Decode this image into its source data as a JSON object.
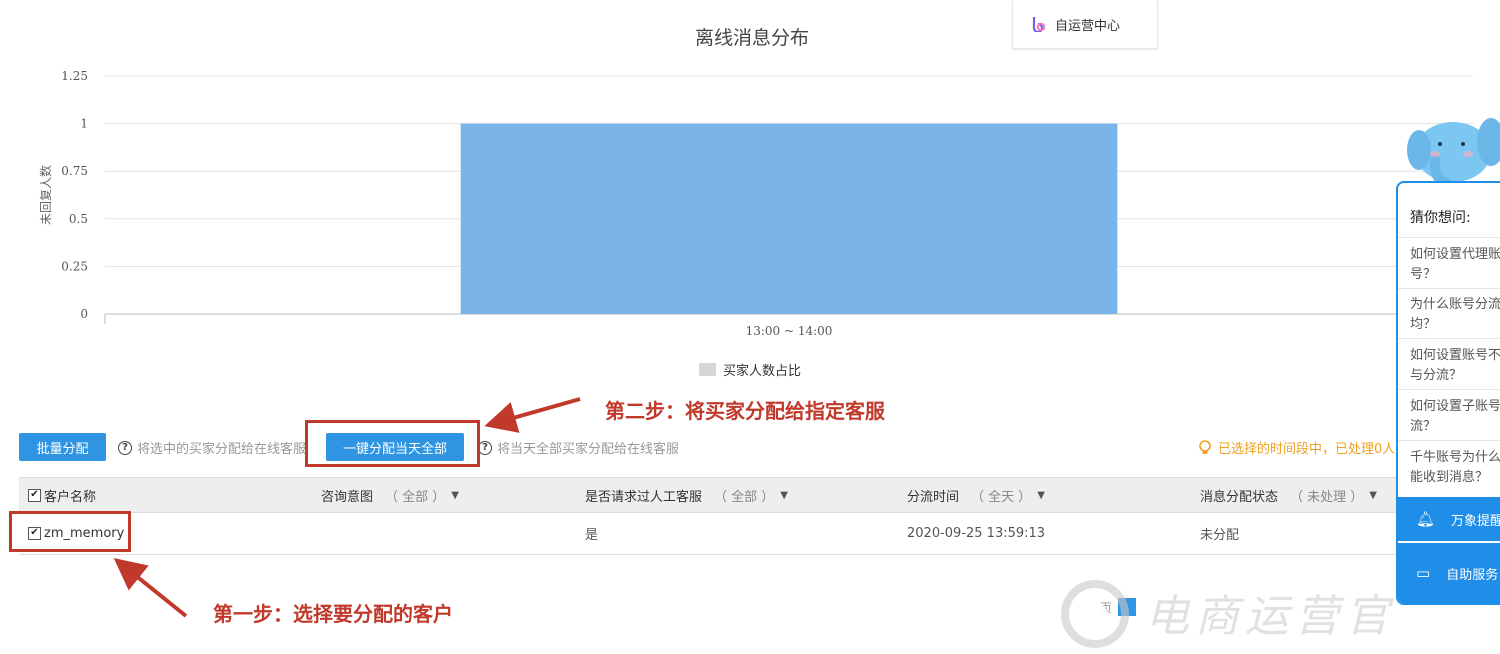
{
  "chart_data": {
    "type": "bar",
    "title": "离线消息分布",
    "categories": [
      "13:00 ~ 14:00"
    ],
    "series": [
      {
        "name": "买家人数占比",
        "values": [
          1
        ]
      }
    ],
    "ylabel": "未回复人数",
    "xlabel": "",
    "ylim": [
      0,
      1.25
    ],
    "yticks": [
      "0",
      "0.25",
      "0.5",
      "0.75",
      "1",
      "1.25"
    ],
    "grid": true,
    "legend": "bottom-center",
    "bar_color": "#7ab4e8",
    "legend_color": "#d6d6d6"
  },
  "popup": {
    "label": "自运营中心"
  },
  "actions": {
    "batch_assign": "批量分配",
    "batch_hint": "将选中的买家分配给在线客服",
    "assign_all": "一键分配当天全部",
    "assign_all_hint": "将当天全部买家分配给在线客服",
    "status_note": "已选择的时间段中，已处理0人"
  },
  "table": {
    "columns": [
      {
        "label": "客户名称",
        "filter": ""
      },
      {
        "label": "咨询意图",
        "filter": "（ 全部 ）"
      },
      {
        "label": "是否请求过人工客服",
        "filter": "（ 全部 ）"
      },
      {
        "label": "分流时间",
        "filter": "（ 全天 ）"
      },
      {
        "label": "消息分配状态",
        "filter": "（ 未处理 ）"
      }
    ],
    "rows": [
      {
        "name": "zm_memory",
        "intent": "",
        "requested_human": "是",
        "time": "2020-09-25 13:59:13",
        "status": "未分配"
      }
    ]
  },
  "annotations": {
    "step1": "第一步：选择要分配的客户",
    "step2": "第二步：将买家分配给指定客服"
  },
  "help_panel": {
    "title": "猜你想问:",
    "questions": [
      [
        "如何设置代理账",
        "号？"
      ],
      [
        "为什么账号分流",
        "均？"
      ],
      [
        "如何设置账号不",
        "与分流？"
      ],
      [
        "如何设置子账号",
        "流？"
      ],
      [
        "千牛账号为什么",
        "能收到消息？"
      ]
    ],
    "reminder": "万象提醒",
    "self_service": "自助服务"
  },
  "pager": {
    "label": "页"
  },
  "watermark": "电商运营官"
}
